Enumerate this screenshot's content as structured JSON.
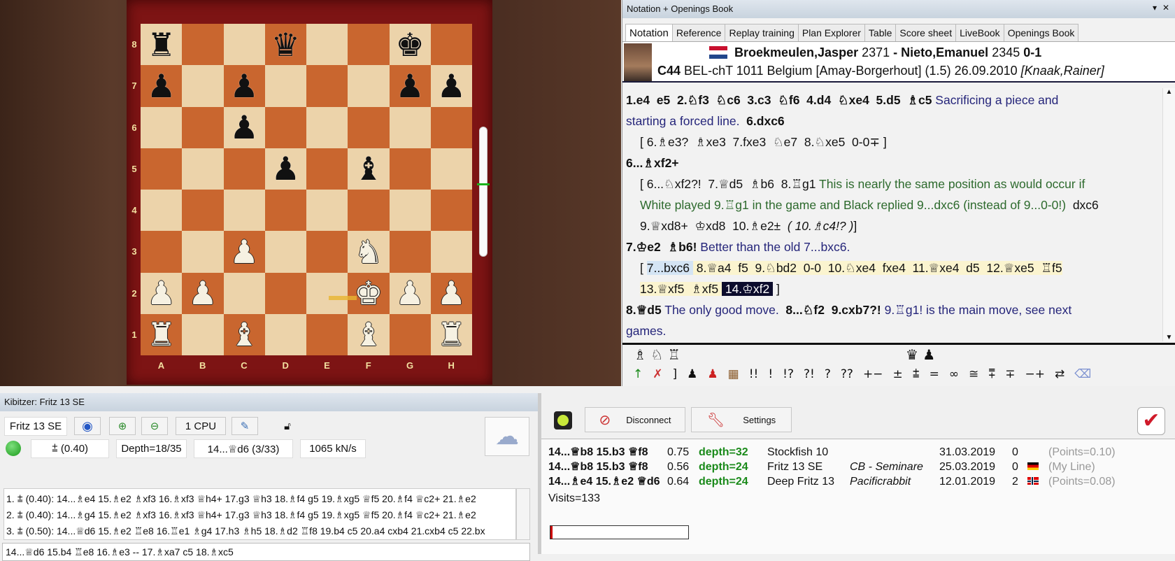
{
  "board": {
    "files": [
      "A",
      "B",
      "C",
      "D",
      "E",
      "F",
      "G",
      "H"
    ],
    "ranks": [
      "8",
      "7",
      "6",
      "5",
      "4",
      "3",
      "2",
      "1"
    ],
    "position": [
      [
        "br",
        "",
        "",
        "bq",
        "",
        "",
        "bk",
        ""
      ],
      [
        "bp",
        "",
        "bp",
        "",
        "",
        "",
        "bp",
        "bp"
      ],
      [
        "",
        "",
        "bp",
        "",
        "",
        "",
        "",
        ""
      ],
      [
        "",
        "",
        "",
        "bp",
        "",
        "bb",
        "",
        ""
      ],
      [
        "",
        "",
        "",
        "",
        "",
        "",
        "",
        ""
      ],
      [
        "",
        "",
        "wp",
        "",
        "",
        "wn",
        "",
        ""
      ],
      [
        "wp",
        "wp",
        "",
        "",
        "",
        "wk",
        "wp",
        "wp"
      ],
      [
        "wr",
        "",
        "wb",
        "",
        "",
        "wb",
        "",
        "wr"
      ]
    ],
    "last_move": "e2-f2",
    "eval_indicator_color": "#1bb31b"
  },
  "notation_panel": {
    "title": "Notation + Openings Book",
    "tabs": [
      {
        "label": "Notation",
        "active": true
      },
      {
        "label": "Reference"
      },
      {
        "label": "Replay training"
      },
      {
        "label": "Plan Explorer"
      },
      {
        "label": "Table"
      },
      {
        "label": "Score sheet"
      },
      {
        "label": "LiveBook"
      },
      {
        "label": "Openings Book"
      }
    ],
    "header": {
      "white": "Broekmeulen,Jasper",
      "white_elo": "2371",
      "sep": " - ",
      "black": "Nieto,Emanuel",
      "black_elo": "2345",
      "result": "0-1",
      "eco": "C44",
      "event": "BEL-chT 1011 Belgium [Amay-Borgerhout] (1.5) 26.09.2010",
      "annotator": "[Knaak,Rainer]"
    },
    "lines": [
      {
        "ind": false,
        "seg": [
          {
            "s": "main",
            "t": "1.e4  e5  2.♘f3  ♘c6  3.c3  ♘f6  4.d4  ♘xe4  5.d5  ♗c5"
          },
          {
            "s": "blue",
            "t": " Sacrificing a piece and"
          }
        ]
      },
      {
        "ind": false,
        "seg": [
          {
            "s": "blue",
            "t": "starting a forced line."
          },
          {
            "s": "main",
            "t": "  6.dxc6"
          }
        ]
      },
      {
        "ind": true,
        "seg": [
          {
            "s": "var",
            "t": "[ 6.♗e3?  ♗xe3  7.fxe3  ♘e7  8.♘xe5  0-0∓ ]"
          }
        ]
      },
      {
        "ind": false,
        "seg": [
          {
            "s": "main",
            "t": "6...♗xf2+"
          }
        ]
      },
      {
        "ind": true,
        "seg": [
          {
            "s": "var",
            "t": "[ 6...♘xf2?!  7.♕d5  ♗b6  8.♖g1"
          },
          {
            "s": "green",
            "t": " This is nearly the same position as would occur if"
          }
        ]
      },
      {
        "ind": true,
        "seg": [
          {
            "s": "green",
            "t": "White played 9.♖g1 in the game and Black replied 9...dxc6 (instead of 9...0-0!)"
          },
          {
            "s": "var",
            "t": "  dxc6"
          }
        ]
      },
      {
        "ind": true,
        "seg": [
          {
            "s": "var",
            "t": "9.♕xd8+  ♔xd8  10.♗e2±"
          },
          {
            "s": "ital",
            "t": "  ( 10.♗c4!? )"
          },
          {
            "s": "var",
            "t": "]"
          }
        ]
      },
      {
        "ind": false,
        "seg": [
          {
            "s": "main",
            "t": "7.♔e2  ♗b6!"
          },
          {
            "s": "blue",
            "t": " Better than the old 7...bxc6."
          }
        ]
      },
      {
        "ind": true,
        "seg": [
          {
            "s": "var",
            "t": "[ "
          },
          {
            "s": "lb",
            "t": "7...bxc6 "
          },
          {
            "s": "yel",
            "t": " 8.♕a4  f5  9.♘bd2  0-0  10.♘xe4  fxe4  11.♕xe4  d5  12.♕xe5  ♖f5"
          }
        ]
      },
      {
        "ind": true,
        "seg": [
          {
            "s": "yel",
            "t": "13.♕xf5  ♗xf5 "
          },
          {
            "s": "sel",
            "t": " 14.♔xf2 "
          },
          {
            "s": "var",
            "t": " ]"
          }
        ]
      },
      {
        "ind": false,
        "seg": [
          {
            "s": "main",
            "t": "8.♕d5"
          },
          {
            "s": "blue",
            "t": " The only good move. "
          },
          {
            "s": "main",
            "t": " 8...♘f2  9.cxb7?!"
          },
          {
            "s": "blue",
            "t": " 9.♖g1! is the main move, see next"
          }
        ]
      },
      {
        "ind": false,
        "seg": [
          {
            "s": "blue",
            "t": "games."
          }
        ]
      }
    ],
    "captured_white": "♗ ♘ ♖",
    "captured_black": "♛ ♟",
    "annotation_symbols": [
      "!!",
      "!",
      "!?",
      "?!",
      "?",
      "??",
      "+−",
      "±",
      "⩲",
      "=",
      "∞",
      "≅",
      "⩱",
      "∓",
      "−+",
      "⇄"
    ]
  },
  "kibitzer": {
    "title": "Kibitzer: Fritz 13 SE",
    "engine": "Fritz 13 SE",
    "cpu": "1 CPU",
    "eval": "⩲ (0.40)",
    "depth": "Depth=18/35",
    "current_move": "14...♕d6 (3/33)",
    "speed": "1065 kN/s",
    "lines": [
      "1. ⩲ (0.40): 14...♗e4 15.♗e2 ♗xf3 16.♗xf3 ♕h4+ 17.g3 ♕h3 18.♗f4 g5 19.♗xg5 ♕f5 20.♗f4 ♕c2+ 21.♗e2",
      "2. ⩲ (0.40): 14...♗g4 15.♗e2 ♗xf3 16.♗xf3 ♕h4+ 17.g3 ♕h3 18.♗f4 g5 19.♗xg5 ♕f5 20.♗f4 ♕c2+ 21.♗e2",
      "3. ⩲ (0.50): 14...♕d6 15.♗e2 ♖e8 16.♖e1 ♗g4 17.h3 ♗h5 18.♗d2 ♖f8 19.b4 c5 20.a4 cxb4 21.cxb4 c5 22.bx"
    ],
    "input_line": "14...♕d6 15.b4 ♖e8 16.♗e3 -- 17.♗xa7 c5 18.♗xc5"
  },
  "livebook": {
    "disconnect": "Disconnect",
    "settings": "Settings",
    "rows": [
      {
        "line": "14...♕b8 15.b3 ♕f8",
        "score": "0.75",
        "depth": "depth=32",
        "engine": "Stockfish 10",
        "user": "",
        "date": "31.03.2019",
        "n": "0",
        "flag": "",
        "note": "(Points=0.10)"
      },
      {
        "line": "14...♕b8 15.b3 ♕f8",
        "score": "0.56",
        "depth": "depth=24",
        "engine": "Fritz 13  SE",
        "user": "CB - Seminare",
        "date": "25.03.2019",
        "n": "0",
        "flag": "germany",
        "note": "(My Line)"
      },
      {
        "line": "14...♗e4 15.♗e2 ♕d6",
        "score": "0.64",
        "depth": "depth=24",
        "engine": "Deep Fritz 13",
        "user": "Pacificrabbit",
        "date": "12.01.2019",
        "n": "2",
        "flag": "norway",
        "note": "(Points=0.08)"
      }
    ],
    "visits": "Visits=133",
    "progress_percent": 1.5
  }
}
